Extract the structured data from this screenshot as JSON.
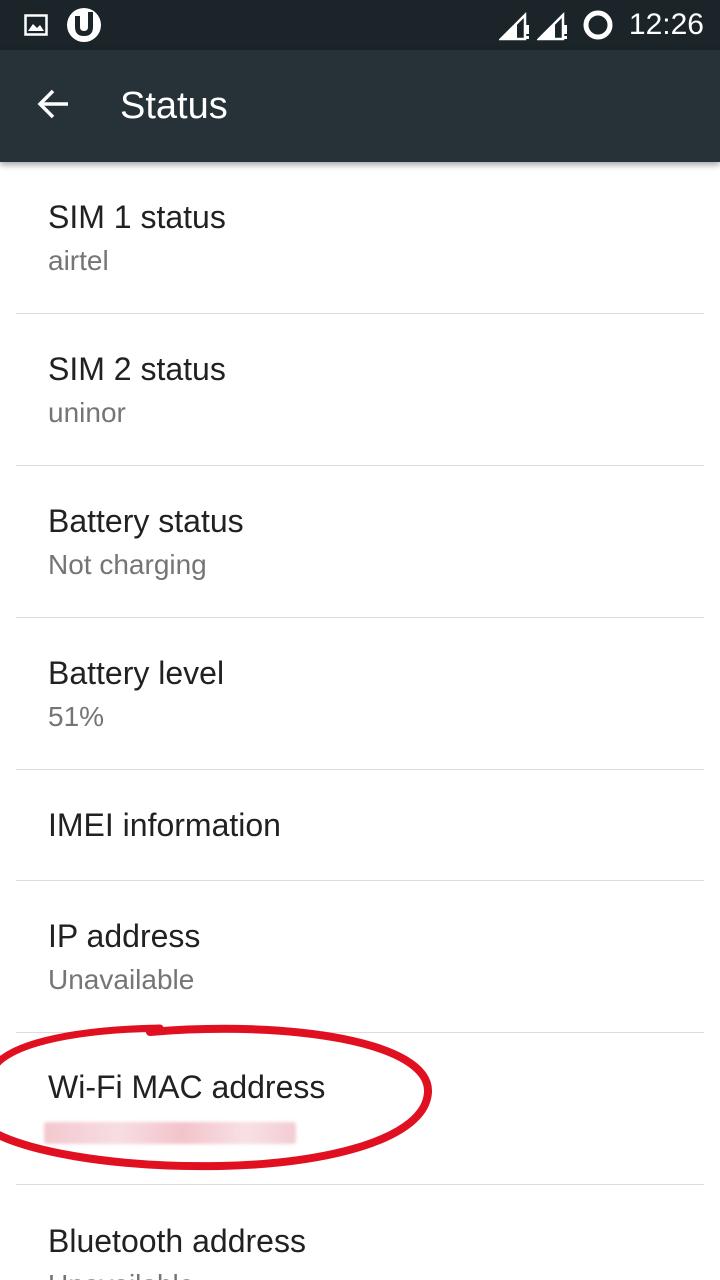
{
  "status_bar": {
    "time": "12:26",
    "icons": [
      "image-notification-icon",
      "utorrent-icon",
      "signal-sim1-icon",
      "signal-sim2-icon",
      "loading-circle-icon"
    ]
  },
  "app_bar": {
    "title": "Status",
    "back_icon": "arrow-back-icon"
  },
  "items": [
    {
      "title": "SIM 1 status",
      "summary": "airtel"
    },
    {
      "title": "SIM 2 status",
      "summary": "uninor"
    },
    {
      "title": "Battery status",
      "summary": "Not charging"
    },
    {
      "title": "Battery level",
      "summary": "51%"
    },
    {
      "title": "IMEI information",
      "summary": ""
    },
    {
      "title": "IP address",
      "summary": "Unavailable"
    },
    {
      "title": "Wi-Fi MAC address",
      "summary": ""
    },
    {
      "title": "Bluetooth address",
      "summary": "Unavailable"
    }
  ],
  "colors": {
    "status_bar": "#1b2428",
    "app_bar": "#263238",
    "annotation_ellipse": "#e01020",
    "title_text": "#212121",
    "summary_text": "#757575"
  }
}
